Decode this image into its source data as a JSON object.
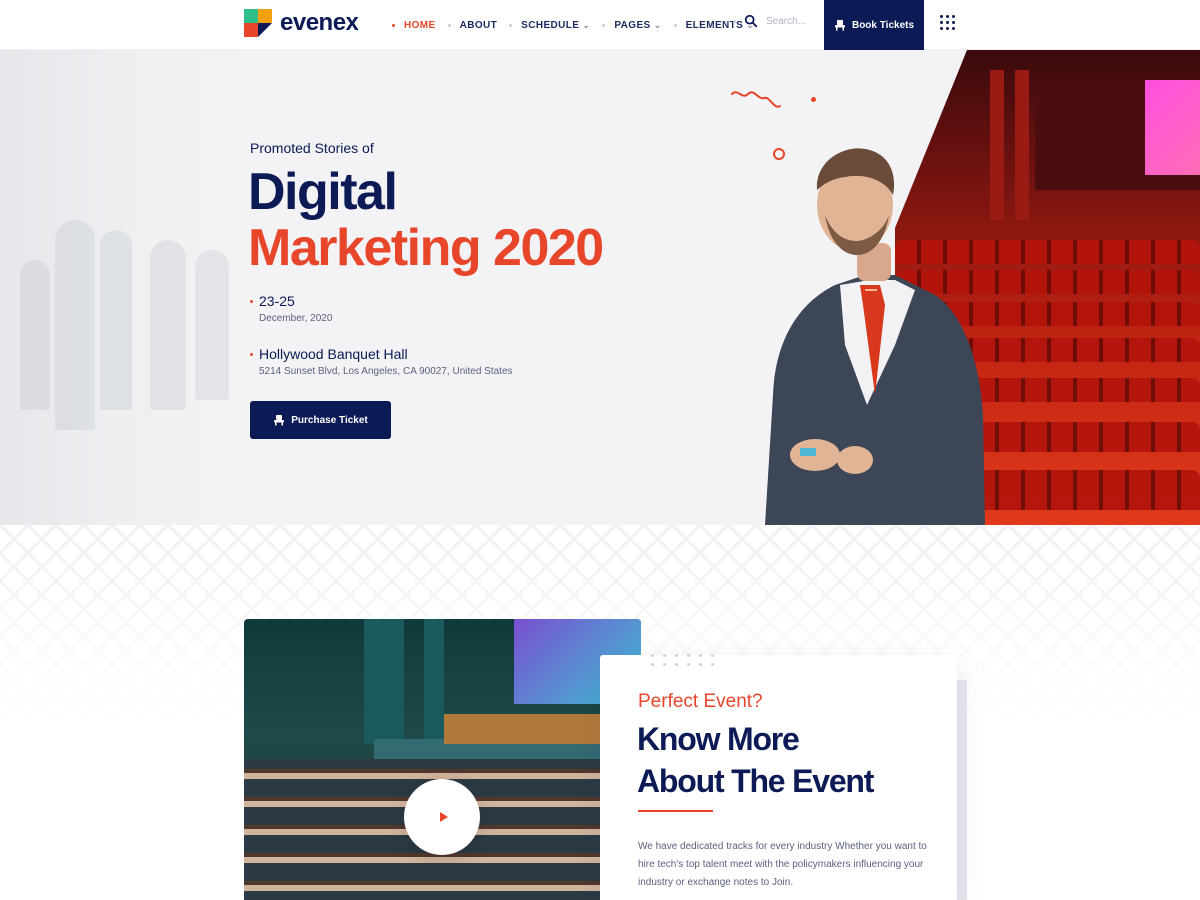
{
  "brand": {
    "name": "evenex"
  },
  "nav": {
    "items": [
      {
        "label": "HOME",
        "active": true,
        "has_dropdown": false
      },
      {
        "label": "ABOUT",
        "active": false,
        "has_dropdown": false
      },
      {
        "label": "SCHEDULE",
        "active": false,
        "has_dropdown": true
      },
      {
        "label": "PAGES",
        "active": false,
        "has_dropdown": true
      },
      {
        "label": "ELEMENTS",
        "active": false,
        "has_dropdown": true
      }
    ],
    "search_placeholder": "Search...",
    "book_button": "Book Tickets",
    "menu_icon": "grid-icon"
  },
  "hero": {
    "kicker": "Promoted Stories of",
    "title_line1": "Digital",
    "title_line2": "Marketing 2020",
    "date_main": "23-25",
    "date_sub": "December, 2020",
    "venue_main": "Hollywood Banquet Hall",
    "venue_sub": "5214 Sunset Blvd, Los Angeles, CA 90027, United States",
    "button": "Purchase Ticket"
  },
  "about": {
    "kicker": "Perfect Event?",
    "title_line1": "Know More",
    "title_line2": "About The Event",
    "body": "We have dedicated tracks for every industry Whether you want to hire tech's top talent meet with the policymakers influencing your industry or exchange notes to Join."
  },
  "colors": {
    "navy": "#0c1a55",
    "accent": "#e8462a",
    "hero_bg": "#f3f3f5",
    "muted_text": "#5b6180"
  }
}
